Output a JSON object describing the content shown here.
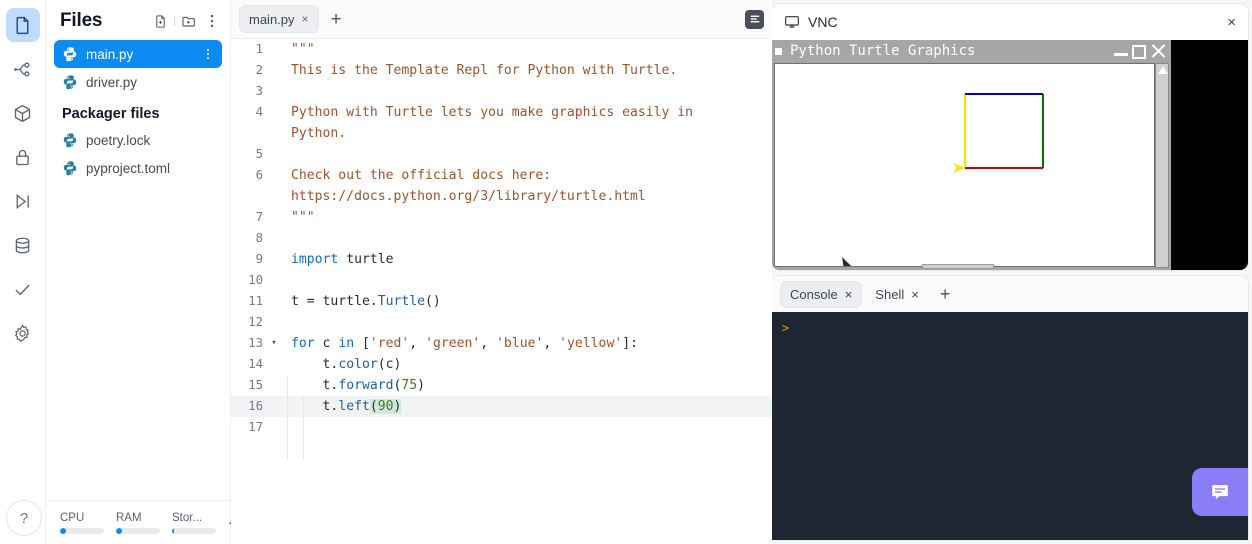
{
  "rail": {
    "items": [
      {
        "name": "files",
        "icon": "file-icon",
        "active": true
      },
      {
        "name": "version-control",
        "icon": "git-branch-icon",
        "active": false
      },
      {
        "name": "packages",
        "icon": "cube-icon",
        "active": false
      },
      {
        "name": "secrets",
        "icon": "lock-icon",
        "active": false
      },
      {
        "name": "debugger",
        "icon": "step-over-icon",
        "active": false
      },
      {
        "name": "database",
        "icon": "database-icon",
        "active": false
      },
      {
        "name": "tests",
        "icon": "check-icon",
        "active": false
      },
      {
        "name": "settings",
        "icon": "gear-icon",
        "active": false
      }
    ],
    "help_label": "?"
  },
  "sidebar": {
    "title": "Files",
    "actions": [
      "new-file-icon",
      "new-folder-icon",
      "more-options-icon"
    ],
    "files": [
      {
        "name": "main.py",
        "selected": true
      },
      {
        "name": "driver.py",
        "selected": false
      }
    ],
    "group_title": "Packager files",
    "packager_files": [
      {
        "name": "poetry.lock",
        "selected": false
      },
      {
        "name": "pyproject.toml",
        "selected": false
      }
    ],
    "status": {
      "meters": [
        {
          "label": "CPU",
          "percent": 14
        },
        {
          "label": "RAM",
          "percent": 14
        },
        {
          "label": "Stor...",
          "percent": 5
        }
      ],
      "collapse_icon": "chevron-up-icon"
    }
  },
  "editor": {
    "tabs": [
      {
        "label": "main.py",
        "close": "×",
        "active": true
      }
    ],
    "add_tab_label": "+",
    "format_icon": "format-code-icon",
    "lines": [
      {
        "num": "1",
        "fold": "",
        "highlight": false,
        "tokens": [
          {
            "t": "\"\"\"",
            "c": "cm"
          }
        ]
      },
      {
        "num": "2",
        "fold": "",
        "highlight": false,
        "tokens": [
          {
            "t": "This is the Template Repl for Python with Turtle.",
            "c": "cm"
          }
        ]
      },
      {
        "num": "3",
        "fold": "",
        "highlight": false,
        "tokens": [
          {
            "t": "",
            "c": "cm"
          }
        ]
      },
      {
        "num": "4",
        "fold": "",
        "highlight": false,
        "tokens": [
          {
            "t": "Python with Turtle lets you make graphics easily in",
            "c": "cm"
          }
        ]
      },
      {
        "num": "",
        "fold": "",
        "highlight": false,
        "tokens": [
          {
            "t": "Python.",
            "c": "cm"
          }
        ]
      },
      {
        "num": "5",
        "fold": "",
        "highlight": false,
        "tokens": [
          {
            "t": "",
            "c": "cm"
          }
        ]
      },
      {
        "num": "6",
        "fold": "",
        "highlight": false,
        "tokens": [
          {
            "t": "Check out the official docs here:",
            "c": "cm"
          }
        ]
      },
      {
        "num": "",
        "fold": "",
        "highlight": false,
        "tokens": [
          {
            "t": "https://docs.python.org/3/library/turtle.html",
            "c": "cm"
          }
        ]
      },
      {
        "num": "7",
        "fold": "",
        "highlight": false,
        "tokens": [
          {
            "t": "\"\"\"",
            "c": "cm"
          }
        ]
      },
      {
        "num": "8",
        "fold": "",
        "highlight": false,
        "tokens": []
      },
      {
        "num": "9",
        "fold": "",
        "highlight": false,
        "tokens": [
          {
            "t": "import",
            "c": "k"
          },
          {
            "t": " turtle",
            "c": ""
          }
        ]
      },
      {
        "num": "10",
        "fold": "",
        "highlight": false,
        "tokens": []
      },
      {
        "num": "11",
        "fold": "",
        "highlight": false,
        "tokens": [
          {
            "t": "t = turtle.",
            "c": ""
          },
          {
            "t": "Turtle",
            "c": "f"
          },
          {
            "t": "()",
            "c": ""
          }
        ]
      },
      {
        "num": "12",
        "fold": "",
        "highlight": false,
        "tokens": []
      },
      {
        "num": "13",
        "fold": "▾",
        "highlight": false,
        "tokens": [
          {
            "t": "for",
            "c": "k"
          },
          {
            "t": " c ",
            "c": ""
          },
          {
            "t": "in",
            "c": "k"
          },
          {
            "t": " [",
            "c": ""
          },
          {
            "t": "'red'",
            "c": "s"
          },
          {
            "t": ", ",
            "c": ""
          },
          {
            "t": "'green'",
            "c": "s"
          },
          {
            "t": ", ",
            "c": ""
          },
          {
            "t": "'blue'",
            "c": "s"
          },
          {
            "t": ", ",
            "c": ""
          },
          {
            "t": "'yellow'",
            "c": "s"
          },
          {
            "t": "]:",
            "c": ""
          }
        ]
      },
      {
        "num": "14",
        "fold": "",
        "highlight": false,
        "tokens": [
          {
            "t": "    t.",
            "c": ""
          },
          {
            "t": "color",
            "c": "f"
          },
          {
            "t": "(c)",
            "c": ""
          }
        ]
      },
      {
        "num": "15",
        "fold": "",
        "highlight": false,
        "tokens": [
          {
            "t": "    t.",
            "c": ""
          },
          {
            "t": "forward",
            "c": "f"
          },
          {
            "t": "(",
            "c": ""
          },
          {
            "t": "75",
            "c": "n"
          },
          {
            "t": ")",
            "c": ""
          }
        ]
      },
      {
        "num": "16",
        "fold": "",
        "highlight": true,
        "tokens": [
          {
            "t": "    t.",
            "c": ""
          },
          {
            "t": "left",
            "c": "f"
          },
          {
            "t": "(",
            "c": "bm"
          },
          {
            "t": "90",
            "c": "n bm"
          },
          {
            "t": ")",
            "c": "bm"
          }
        ]
      },
      {
        "num": "17",
        "fold": "",
        "highlight": false,
        "tokens": []
      }
    ]
  },
  "vnc": {
    "title": "VNC",
    "monitor_icon": "monitor-icon",
    "close_label": "×",
    "turtle_window": {
      "title": "Python Turtle Graphics",
      "minimize_icon": "minimize-icon",
      "maximize_icon": "maximize-icon",
      "close_icon": "close-icon"
    },
    "drawing": {
      "description": "square drawn by turtle",
      "sides": [
        {
          "side": "left",
          "color": "#ffe400"
        },
        {
          "side": "top",
          "color": "#0000d0"
        },
        {
          "side": "right",
          "color": "#007000"
        },
        {
          "side": "bottom",
          "color": "#d00000"
        }
      ],
      "turtle_color": "#ffe400",
      "side_length": 75
    }
  },
  "console": {
    "tabs": [
      {
        "label": "Console",
        "close": "×",
        "active": true
      },
      {
        "label": "Shell",
        "close": "×",
        "active": false
      }
    ],
    "add_label": "+",
    "prompt": ">",
    "chat_icon": "chat-bubble-icon"
  },
  "colors": {
    "accent_blue": "#0d8bf2",
    "selection_blue": "#bfdbfe",
    "console_bg": "#1e2533",
    "prompt_yellow": "#d4af0f",
    "chat_purple": "#8b7cf8",
    "string_brown": "#a0522d",
    "keyword_blue": "#0b6fc4",
    "number_green": "#3f7a23"
  }
}
